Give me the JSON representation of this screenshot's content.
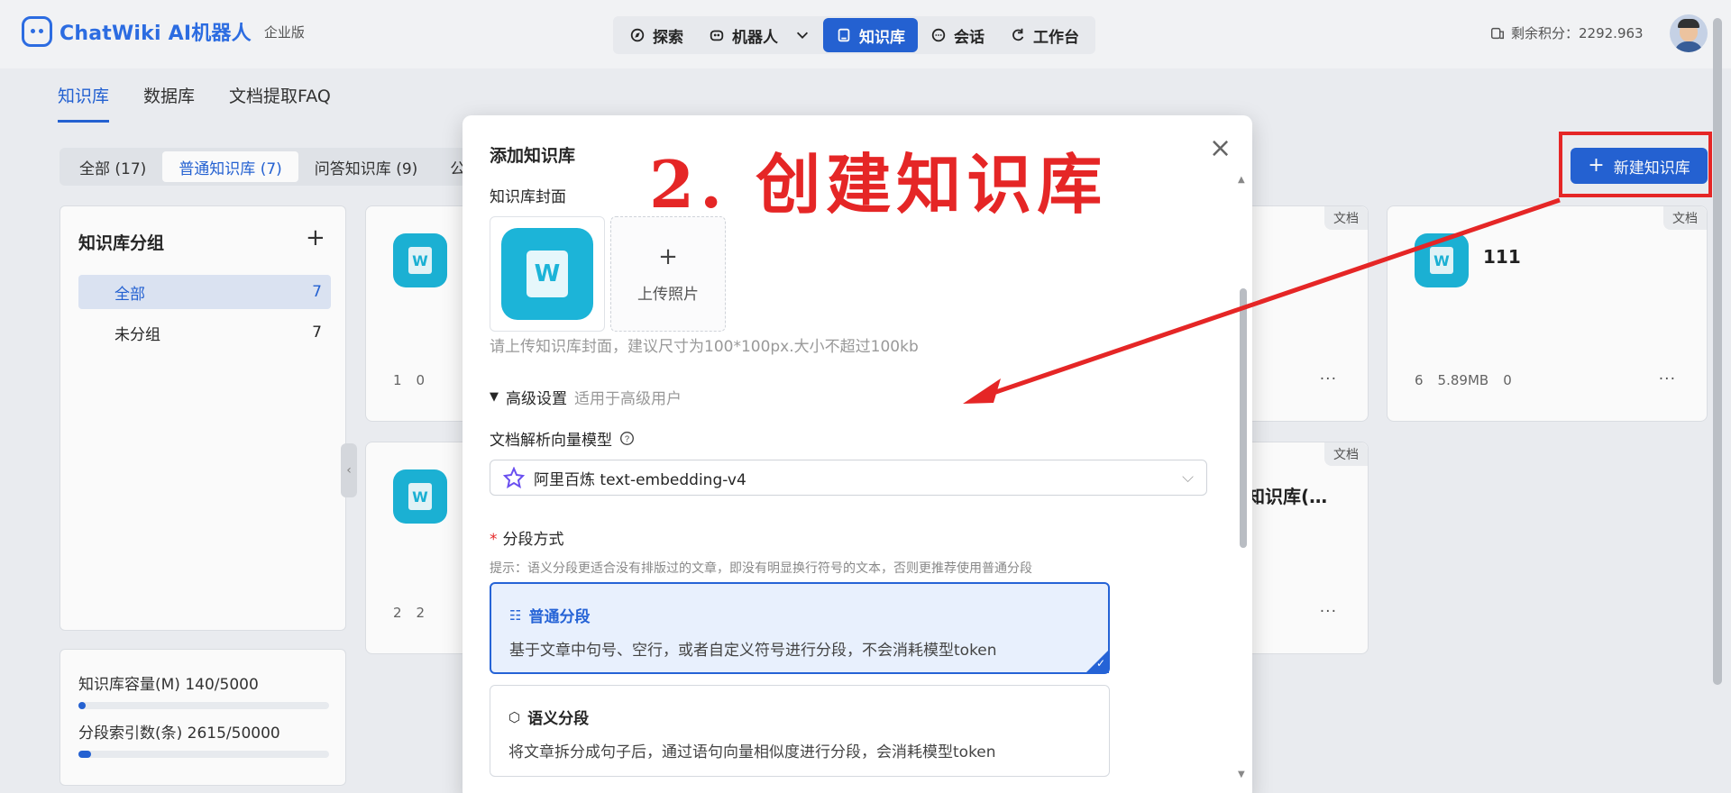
{
  "header": {
    "logo_text": "ChatWiki AI机器人",
    "edition": "企业版",
    "nav": [
      {
        "label": "探索",
        "icon": "compass-icon"
      },
      {
        "label": "机器人",
        "icon": "robot-icon"
      },
      {
        "label": "知识库",
        "icon": "book-icon",
        "active": true
      },
      {
        "label": "会话",
        "icon": "chat-icon"
      },
      {
        "label": "工作台",
        "icon": "refresh-icon"
      }
    ],
    "points": "剩余积分：2292.963"
  },
  "page_tabs": [
    "知识库",
    "数据库",
    "文档提取FAQ"
  ],
  "filters": [
    "全部 (17)",
    "普通知识库 (7)",
    "问答知识库 (9)",
    "公"
  ],
  "new_kb_button": "新建知识库",
  "groups": {
    "title": "知识库分组",
    "items": [
      {
        "label": "全部",
        "count": "7"
      },
      {
        "label": "未分组",
        "count": "7"
      }
    ]
  },
  "usage": {
    "capacity_label": "知识库容量(M) 140/5000",
    "capacity_ratio": 0.028,
    "index_label": "分段索引数(条) 2615/50000",
    "index_ratio": 0.052
  },
  "cards": [
    {
      "tag": "",
      "name": "",
      "stats": [
        "1",
        "0"
      ]
    },
    {
      "tag": "文档",
      "name": "",
      "stats": []
    },
    {
      "tag": "文档",
      "name": "111",
      "stats": [
        "6",
        "5.89MB",
        "0"
      ]
    },
    {
      "tag": "",
      "name": "",
      "stats": [
        "2",
        "2"
      ]
    },
    {
      "tag": "文档",
      "name": "知识库(…",
      "stats": []
    }
  ],
  "modal": {
    "title": "添加知识库",
    "cover_label": "知识库封面",
    "upload_label": "上传照片",
    "cover_hint": "请上传知识库封面，建议尺寸为100*100px.大小不超过100kb",
    "advanced": "高级设置",
    "advanced_hint": "适用于高级用户",
    "model_label": "文档解析向量模型",
    "model_value": "阿里百炼 text-embedding-v4",
    "split_label": "分段方式",
    "split_tip": "提示：语义分段更适合没有排版过的文章，即没有明显换行符号的文本，否则更推荐使用普通分段",
    "options": [
      {
        "title": "普通分段",
        "desc": "基于文章中句号、空行，或者自定义符号进行分段，不会消耗模型token",
        "selected": true
      },
      {
        "title": "语义分段",
        "desc": "将文章拆分成句子后，通过语句向量相似度进行分段，会消耗模型token",
        "selected": false
      }
    ]
  },
  "annotation": "2. 创建知识库",
  "colors": {
    "primary": "#2563d6",
    "annotation": "#e52626",
    "icon_bg": "#1cb4d8"
  }
}
